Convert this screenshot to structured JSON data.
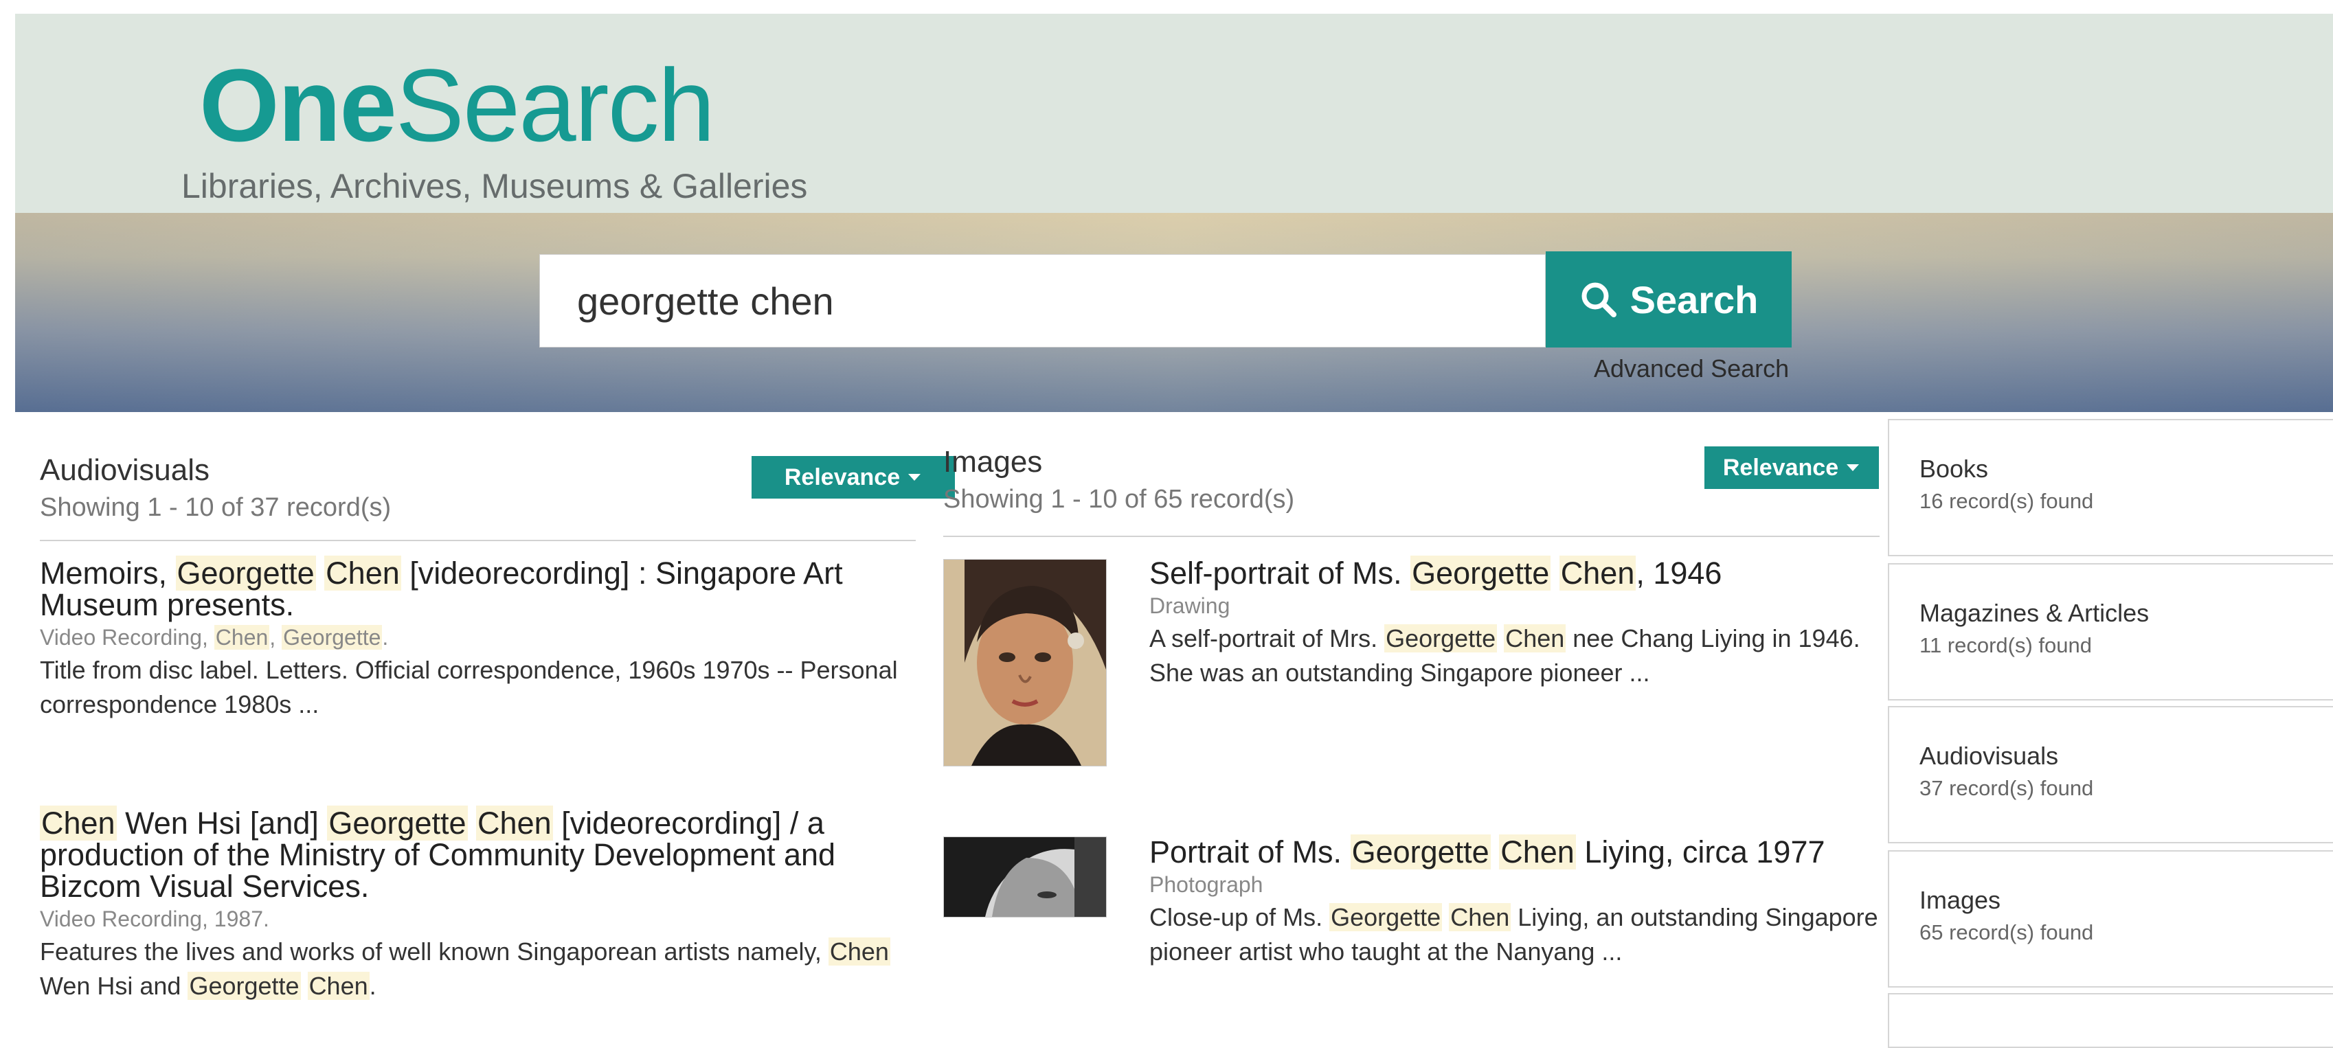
{
  "logo": {
    "brand_bold": "One",
    "brand_regular": "Search",
    "tagline": "Libraries, Archives, Museums & Galleries"
  },
  "search": {
    "query": "georgette chen",
    "button_label": "Search",
    "advanced_label": "Advanced Search"
  },
  "audiovisuals": {
    "title": "Audiovisuals",
    "count": "Showing 1 - 10 of 37 record(s)",
    "sort_label": "Relevance",
    "results": [
      {
        "title_html": "Memoirs, <mark>Georgette</mark> <mark>Chen</mark> [videorecording] : Singapore Art Museum presents.",
        "type_html": "Video Recording, <mark>Chen</mark>, <mark>Georgette</mark>.",
        "desc": "Title from disc label. Letters. Official correspondence, 1960s 1970s -- Personal correspondence 1980s ..."
      },
      {
        "title_html": "<mark>Chen</mark> Wen Hsi [and] <mark>Georgette</mark> <mark>Chen</mark> [videorecording] / a production of the Ministry of Community Development and Bizcom Visual Services.",
        "type_html": "Video Recording, 1987.",
        "desc_html": "Features the lives and works of well known Singaporean artists namely, <mark>Chen</mark> Wen Hsi and <mark>Georgette</mark> <mark>Chen</mark>."
      }
    ]
  },
  "images": {
    "title": "Images",
    "count": "Showing 1 - 10 of 65 record(s)",
    "sort_label": "Relevance",
    "results": [
      {
        "title_html": "Self-portrait of Ms. <mark>Georgette</mark> <mark>Chen</mark>, 1946",
        "type": "Drawing",
        "desc_html": "A self-portrait of Mrs. <mark>Georgette</mark> <mark>Chen</mark> nee Chang Liying in 1946. She was an outstanding Singapore pioneer ..."
      },
      {
        "title_html": "Portrait of Ms. <mark>Georgette</mark> <mark>Chen</mark> Liying, circa 1977",
        "type": "Photograph",
        "desc_html": "Close-up of Ms. <mark>Georgette</mark> <mark>Chen</mark> Liying, an outstanding Singapore pioneer artist who taught at the Nanyang ..."
      }
    ]
  },
  "sidebar": [
    {
      "label": "Books",
      "count": "16 record(s) found"
    },
    {
      "label": "Magazines & Articles",
      "count": "11 record(s) found"
    },
    {
      "label": "Audiovisuals",
      "count": "37 record(s) found"
    },
    {
      "label": "Images",
      "count": "65 record(s) found"
    }
  ],
  "colors": {
    "accent": "#199189",
    "logo": "#169a92",
    "header_bg": "#dde6df",
    "highlight": "#fbf4d8"
  },
  "icons": {
    "search_button_icon": "search-icon",
    "dropdown_icon": "caret-down-icon"
  }
}
